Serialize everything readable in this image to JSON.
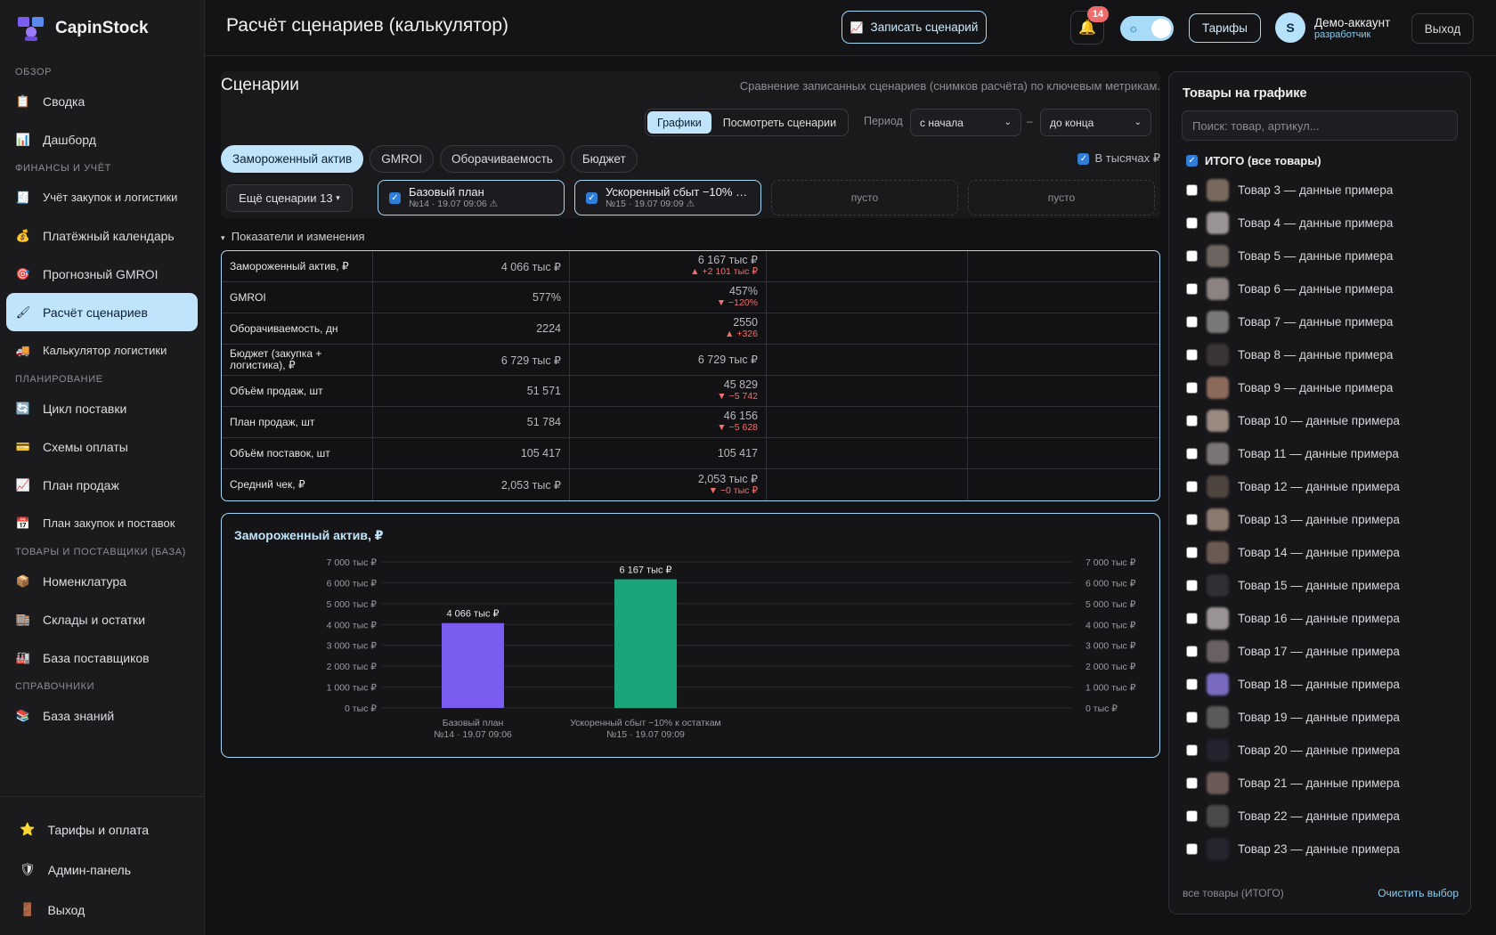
{
  "brand": {
    "name": "CapinStock"
  },
  "sidebar": {
    "groups": [
      {
        "label": "ОБЗОР",
        "items": [
          {
            "label": "Сводка",
            "icon": "clipboard-icon"
          },
          {
            "label": "Дашборд",
            "icon": "bar-chart-icon"
          }
        ]
      },
      {
        "label": "ФИНАНСЫ И УЧЁТ",
        "items": [
          {
            "label": "Учёт закупок и логистики",
            "icon": "receipt-icon"
          },
          {
            "label": "Платёжный календарь",
            "icon": "money-bag-icon"
          },
          {
            "label": "Прогнозный GMROI",
            "icon": "target-icon"
          },
          {
            "label": "Расчёт сценариев",
            "icon": "brush-icon",
            "active": true
          },
          {
            "label": "Калькулятор логистики",
            "icon": "truck-icon"
          }
        ]
      },
      {
        "label": "ПЛАНИРОВАНИЕ",
        "items": [
          {
            "label": "Цикл поставки",
            "icon": "cycle-icon"
          },
          {
            "label": "Схемы оплаты",
            "icon": "card-icon"
          },
          {
            "label": "План продаж",
            "icon": "trend-icon"
          },
          {
            "label": "План закупок и поставок",
            "icon": "calendar-icon"
          }
        ]
      },
      {
        "label": "ТОВАРЫ И ПОСТАВЩИКИ (БАЗА)",
        "items": [
          {
            "label": "Номенклатура",
            "icon": "box-icon"
          },
          {
            "label": "Склады и остатки",
            "icon": "warehouse-icon"
          },
          {
            "label": "База поставщиков",
            "icon": "factory-icon"
          }
        ]
      },
      {
        "label": "СПРАВОЧНИКИ",
        "items": [
          {
            "label": "База знаний",
            "icon": "books-icon"
          }
        ]
      }
    ],
    "bottom": [
      {
        "label": "Тарифы и оплата",
        "icon": "star-icon"
      },
      {
        "label": "Админ-панель",
        "icon": "shield-icon"
      },
      {
        "label": "Выход",
        "icon": "door-icon"
      }
    ]
  },
  "header": {
    "title": "Расчёт сценариев (калькулятор)",
    "record_label": "Записать сценарий",
    "notifications": "14",
    "tariffs_label": "Тарифы",
    "user_initial": "S",
    "user_name": "Демо-аккаунт",
    "user_role": "разработчик",
    "exit_label": "Выход"
  },
  "scenarios": {
    "title": "Сценарии",
    "subtitle": "Сравнение записанных сценариев (снимков расчёта) по ключевым метрикам.",
    "view_tabs": [
      "Графики",
      "Посмотреть сценарии"
    ],
    "period_label": "Период",
    "period_from": "с начала",
    "period_dash": "–",
    "period_to": "до конца",
    "metric_chips": [
      "Замороженный актив",
      "GMROI",
      "Оборачиваемость",
      "Бюджет"
    ],
    "thousands_label": "В тысячах ₽",
    "more_label": "Ещё сценарии 13",
    "slots": [
      {
        "title": "Базовый план",
        "meta": "№14 · 19.07 09:06 ⚠"
      },
      {
        "title": "Ускоренный сбыт −10% …",
        "meta": "№15 · 19.07 09:09 ⚠"
      }
    ],
    "empty_label": "пусто",
    "section_label": "Показатели и изменения"
  },
  "metrics": [
    {
      "label": "Замороженный актив, ₽",
      "v1": "4 066 тыс ₽",
      "v2": "6 167 тыс ₽",
      "delta": "▲ +2 101 тыс ₽"
    },
    {
      "label": "GMROI",
      "v1": "577%",
      "v2": "457%",
      "delta": "▼ −120%"
    },
    {
      "label": "Оборачиваемость, дн",
      "v1": "2224",
      "v2": "2550",
      "delta": "▲ +326"
    },
    {
      "label": "Бюджет (закупка + логистика), ₽",
      "v1": "6 729 тыс ₽",
      "v2": "6 729 тыс ₽",
      "delta": ""
    },
    {
      "label": "Объём продаж, шт",
      "v1": "51 571",
      "v2": "45 829",
      "delta": "▼ −5 742"
    },
    {
      "label": "План продаж, шт",
      "v1": "51 784",
      "v2": "46 156",
      "delta": "▼ −5 628"
    },
    {
      "label": "Объём поставок, шт",
      "v1": "105 417",
      "v2": "105 417",
      "delta": ""
    },
    {
      "label": "Средний чек, ₽",
      "v1": "2,053 тыс ₽",
      "v2": "2,053 тыс ₽",
      "delta": "▼ −0 тыс ₽"
    }
  ],
  "chart_data": {
    "type": "bar",
    "title": "Замороженный актив, ₽",
    "categories": [
      "Базовый план\n№14 · 19.07 09:06",
      "Ускоренный сбыт −10% к остаткам\n№15 · 19.07 09:09"
    ],
    "values": [
      4066,
      6167
    ],
    "value_labels": [
      "4 066 тыс ₽",
      "6 167 тыс ₽"
    ],
    "colors": [
      "#7b5cf0",
      "#1aa57a"
    ],
    "ylim": [
      0,
      7000
    ],
    "yticks": [
      "0 тыс ₽",
      "1 000 тыс ₽",
      "2 000 тыс ₽",
      "3 000 тыс ₽",
      "4 000 тыс ₽",
      "5 000 тыс ₽",
      "6 000 тыс ₽",
      "7 000 тыс ₽"
    ],
    "grid": true
  },
  "products": {
    "title": "Товары на графике",
    "search_placeholder": "Поиск: товар, артикул...",
    "all_label": "ИТОГО (все товары)",
    "items": [
      "Товар 3 — данные примера",
      "Товар 4 — данные примера",
      "Товар 5 — данные примера",
      "Товар 6 — данные примера",
      "Товар 7 — данные примера",
      "Товар 8 — данные примера",
      "Товар 9 — данные примера",
      "Товар 10 — данные примера",
      "Товар 11 — данные примера",
      "Товар 12 — данные примера",
      "Товар 13 — данные примера",
      "Товар 14 — данные примера",
      "Товар 15 — данные примера",
      "Товар 16 — данные примера",
      "Товар 17 — данные примера",
      "Товар 18 — данные примера",
      "Товар 19 — данные примера",
      "Товар 20 — данные примера",
      "Товар 21 — данные примера",
      "Товар 22 — данные примера",
      "Товар 23 — данные примера"
    ],
    "thumb_colors": [
      "#7a6a5e",
      "#9a9494",
      "#6d6462",
      "#8c8280",
      "#7b7878",
      "#3a3434",
      "#8a6a5a",
      "#9a8a80",
      "#7a7474",
      "#4e4440",
      "#8a7a70",
      "#6a5a52",
      "#303034",
      "#9a9494",
      "#6a6262",
      "#7a6ac0",
      "#5a5a5a",
      "#24222e",
      "#6a5a58",
      "#4a4a4a",
      "#26242e"
    ],
    "footer": "все товары (ИТОГО)",
    "clear_label": "Очистить выбор"
  }
}
